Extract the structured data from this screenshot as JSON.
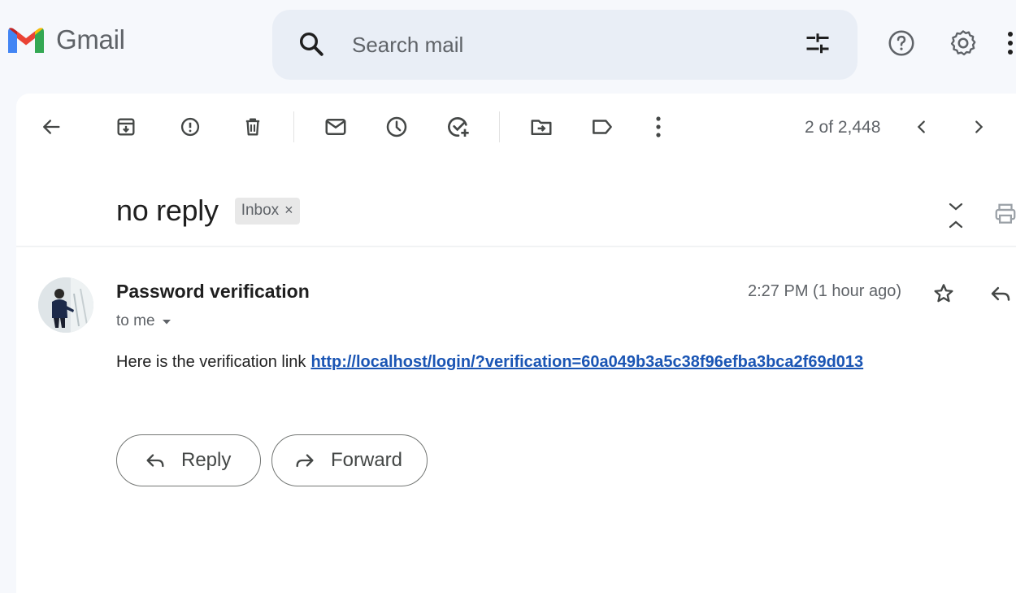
{
  "app": {
    "name": "Gmail"
  },
  "search": {
    "placeholder": "Search mail"
  },
  "toolbar": {
    "pagination": "2 of 2,448"
  },
  "message": {
    "subject": "no reply",
    "label": "Inbox",
    "label_remove": "×",
    "sender": "Password verification",
    "recipient": "to me",
    "time": "2:27 PM (1 hour ago)",
    "body_prefix": "Here is the verification link",
    "link": "http://localhost/login/?verification=60a049b3a5c38f96efba3bca2f69d013"
  },
  "actions": {
    "reply_label": "Reply",
    "forward_label": "Forward"
  },
  "colors": {
    "link": "#1a55b4",
    "search_bg": "#e9eef6",
    "page_bg": "#f6f8fc"
  }
}
